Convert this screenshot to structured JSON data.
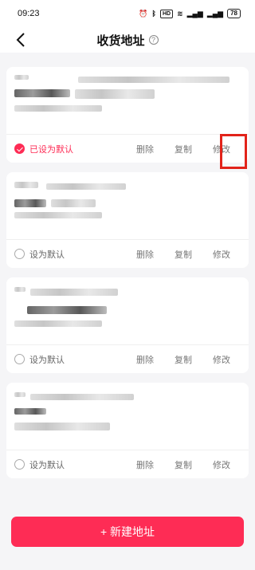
{
  "status_bar": {
    "time": "09:23",
    "battery": "78"
  },
  "header": {
    "title": "收货地址",
    "help_glyph": "?"
  },
  "addresses": [
    {
      "default_label": "已设为默认",
      "is_default": true,
      "delete": "删除",
      "copy": "复制",
      "edit": "修改"
    },
    {
      "default_label": "设为默认",
      "is_default": false,
      "delete": "删除",
      "copy": "复制",
      "edit": "修改"
    },
    {
      "default_label": "设为默认",
      "is_default": false,
      "delete": "删除",
      "copy": "复制",
      "edit": "修改"
    },
    {
      "default_label": "设为默认",
      "is_default": false,
      "delete": "删除",
      "copy": "复制",
      "edit": "修改"
    }
  ],
  "footer": {
    "new_address_label": "+ 新建地址"
  },
  "colors": {
    "accent": "#fe2c55",
    "highlight": "#e2231a"
  }
}
